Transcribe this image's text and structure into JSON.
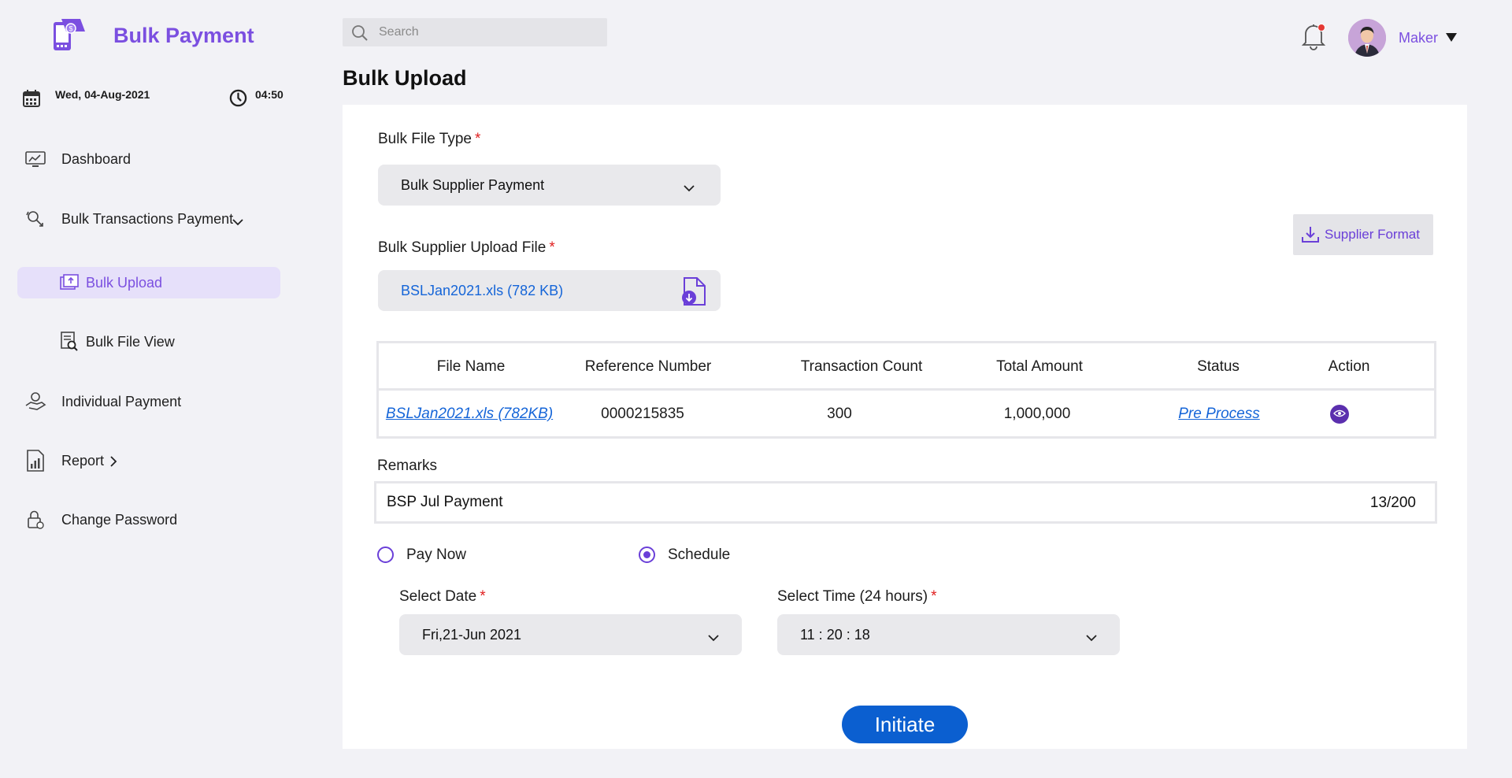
{
  "app": {
    "brand": "Bulk Payment",
    "accent_color": "#7b4fe0",
    "link_color": "#1565d8"
  },
  "sidebar": {
    "date": "Wed, 04-Aug-2021",
    "time": "04:50",
    "items": [
      {
        "label": "Dashboard",
        "icon": "dashboard-icon"
      },
      {
        "label": "Bulk Transactions Payment",
        "icon": "transactions-icon",
        "expand": "chevron-down-icon"
      },
      {
        "label": "Bulk Upload",
        "icon": "upload-icon",
        "active": true
      },
      {
        "label": "Bulk File View",
        "icon": "file-search-icon"
      },
      {
        "label": "Individual Payment",
        "icon": "hand-payment-icon"
      },
      {
        "label": "Report",
        "icon": "report-icon",
        "expand": "chevron-right-icon"
      },
      {
        "label": "Change Password",
        "icon": "lock-icon"
      }
    ]
  },
  "header": {
    "search_placeholder": "Search",
    "notification_icon": "bell-icon",
    "user_name": "Maker"
  },
  "page": {
    "title": "Bulk Upload"
  },
  "form": {
    "file_type_label": "Bulk File Type",
    "file_type_value": "Bulk Supplier Payment",
    "upload_label": "Bulk Supplier Upload File",
    "upload_value": "BSLJan2021.xls (782 KB)",
    "supplier_format_label": "Supplier Format",
    "required_mark": "*"
  },
  "table": {
    "headers": [
      "File Name",
      "Reference Number",
      "Transaction Count",
      "Total Amount",
      "Status",
      "Action"
    ],
    "rows": [
      {
        "file_name": "BSLJan2021.xls (782KB)",
        "reference_number": "0000215835",
        "transaction_count": "300",
        "total_amount": "1,000,000",
        "status": "Pre Process",
        "action_icon": "eye-icon"
      }
    ]
  },
  "remarks": {
    "label": "Remarks",
    "value": "BSP Jul Payment",
    "count": "13/200"
  },
  "payment_mode": {
    "options": [
      "Pay Now",
      "Schedule"
    ],
    "selected": "Schedule"
  },
  "schedule": {
    "date_label": "Select Date",
    "date_value": "Fri,21-Jun 2021",
    "time_label": "Select Time (24 hours)",
    "time_value": "11 : 20 : 18"
  },
  "actions": {
    "initiate_label": "Initiate"
  }
}
